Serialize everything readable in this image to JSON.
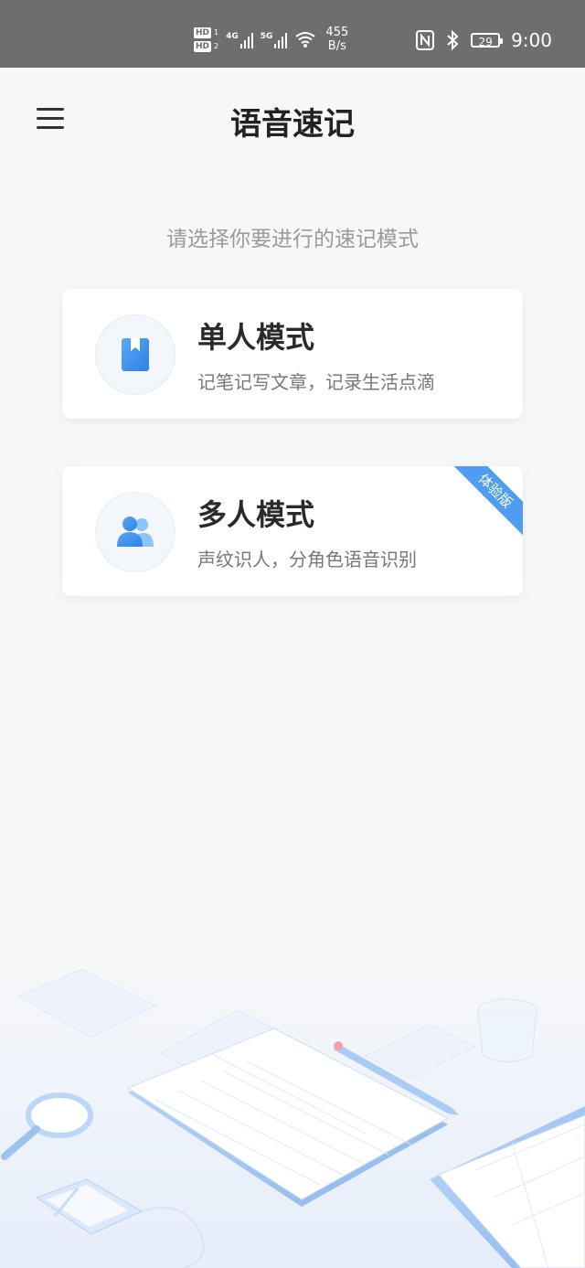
{
  "status_bar": {
    "hd_badge_top": "HD",
    "hd_badge_bottom": "HD",
    "hd_sub_top": "1",
    "hd_sub_bottom": "2",
    "net1_label": "4G",
    "net2_label": "5G",
    "speed_value": "455",
    "speed_unit": "B/s",
    "battery_level": "29",
    "time": "9:00"
  },
  "header": {
    "title": "语音速记"
  },
  "prompt": "请选择你要进行的速记模式",
  "modes": [
    {
      "title": "单人模式",
      "description": "记笔记写文章，记录生活点滴",
      "icon": "bookmark-book-icon"
    },
    {
      "title": "多人模式",
      "description": "声纹识人，分角色语音识别",
      "icon": "users-icon",
      "badge": "体验版"
    }
  ],
  "colors": {
    "accent": "#3a8ef0",
    "status_bar_bg": "#6e6e6e",
    "page_bg": "#f6f7f9"
  }
}
